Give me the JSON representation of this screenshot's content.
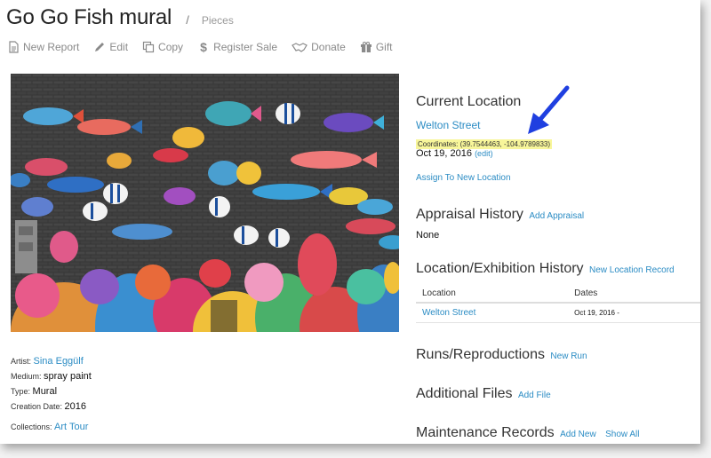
{
  "page": {
    "title": "Go Go Fish mural",
    "separator": "/",
    "breadcrumb": "Pieces"
  },
  "toolbar": [
    {
      "label": "New Report",
      "icon": "document-icon"
    },
    {
      "label": "Edit",
      "icon": "pencil-icon"
    },
    {
      "label": "Copy",
      "icon": "copy-icon"
    },
    {
      "label": "Register Sale",
      "icon": "dollar-icon"
    },
    {
      "label": "Donate",
      "icon": "handshake-icon"
    },
    {
      "label": "Gift",
      "icon": "gift-icon"
    }
  ],
  "details": {
    "artist_label": "Artist:",
    "artist": "Sina Eggülf",
    "medium_label": "Medium:",
    "medium": "spray paint",
    "type_label": "Type:",
    "type": "Mural",
    "creation_label": "Creation Date:",
    "creation_date": "2016",
    "collections_label": "Collections:",
    "collections": "Art Tour"
  },
  "current_location": {
    "title": "Current Location",
    "location": "Welton Street",
    "coordinates": "Coordinates: (39.7544463, -104.9789833)",
    "date": "Oct 19, 2016",
    "edit": "(edit)",
    "assign": "Assign To New Location"
  },
  "appraisal": {
    "title": "Appraisal History",
    "action": "Add Appraisal",
    "value": "None"
  },
  "exhibition": {
    "title": "Location/Exhibition History",
    "action": "New Location Record",
    "headers": [
      "Location",
      "Dates"
    ],
    "rows": [
      {
        "location": "Welton Street",
        "dates": "Oct 19, 2016 -"
      }
    ]
  },
  "runs": {
    "title": "Runs/Reproductions",
    "action": "New Run"
  },
  "files": {
    "title": "Additional Files",
    "action": "Add File"
  },
  "maintenance": {
    "title": "Maintenance Records",
    "action": "Add New",
    "action2": "Show All"
  },
  "colors": {
    "link": "#2b8cc4",
    "highlight": "#f8f69a",
    "arrow": "#1f3fe0"
  }
}
